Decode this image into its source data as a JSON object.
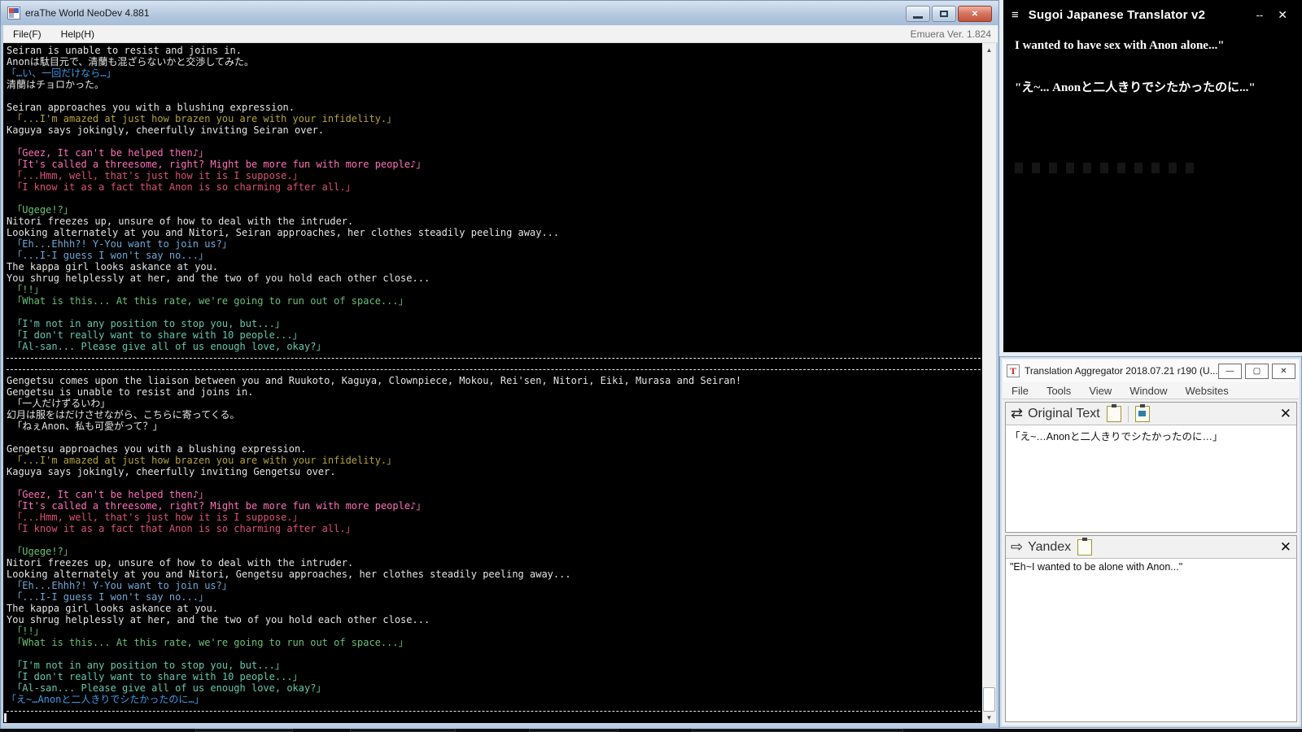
{
  "colors": {
    "white": "#e4e4e4",
    "blue": "#3f9ce8",
    "olive": "#b5a23a",
    "pink": "#ff70b8",
    "crimson": "#dc5078",
    "green": "#68c078",
    "steel": "#6fa8d8",
    "teal": "#63c7ad"
  },
  "era_window": {
    "title": "eraThe World NeoDev 4.881",
    "menu": {
      "file": "File(F)",
      "help": "Help(H)",
      "version": "Emuera Ver. 1.824"
    },
    "console_lines": [
      {
        "color": "white",
        "text": "Seiran is unable to resist and joins in."
      },
      {
        "color": "white",
        "text": "Anonは駄目元で、清蘭も混ざらないかと交渉してみた。"
      },
      {
        "color": "blue",
        "text": "「…い、一回だけなら…」"
      },
      {
        "color": "white",
        "text": "清蘭はチョロかった。"
      },
      {
        "color": "white",
        "text": ""
      },
      {
        "color": "white",
        "text": "Seiran approaches you with a blushing expression."
      },
      {
        "color": "olive",
        "text": " 「...I'm amazed at just how brazen you are with your infidelity.」"
      },
      {
        "color": "white",
        "text": "Kaguya says jokingly, cheerfully inviting Seiran over."
      },
      {
        "color": "white",
        "text": ""
      },
      {
        "color": "pink",
        "text": " 「Geez, It can't be helped then♪」"
      },
      {
        "color": "pink",
        "text": " 「It's called a threesome, right? Might be more fun with more people♪」"
      },
      {
        "color": "crimson",
        "text": " 「...Hmm, well, that's just how it is I suppose.」"
      },
      {
        "color": "crimson",
        "text": " 「I know it as a fact that Anon is so charming after all.」"
      },
      {
        "color": "white",
        "text": ""
      },
      {
        "color": "green",
        "text": " 「Ugege!?」"
      },
      {
        "color": "white",
        "text": "Nitori freezes up, unsure of how to deal with the intruder."
      },
      {
        "color": "white",
        "text": "Looking alternately at you and Nitori, Seiran approaches, her clothes steadily peeling away..."
      },
      {
        "color": "steel",
        "text": " 「Eh...Ehhh?! Y-You want to join us?」"
      },
      {
        "color": "steel",
        "text": " 「...I-I guess I won't say no...」"
      },
      {
        "color": "white",
        "text": "The kappa girl looks askance at you."
      },
      {
        "color": "white",
        "text": "You shrug helplessly at her, and the two of you hold each other close..."
      },
      {
        "color": "green",
        "text": " 「!!」"
      },
      {
        "color": "green",
        "text": " 「What is this... At this rate, we're going to run out of space...」"
      },
      {
        "color": "white",
        "text": ""
      },
      {
        "color": "teal",
        "text": " 「I'm not in any position to stop you, but...」"
      },
      {
        "color": "teal",
        "text": " 「I don't really want to share with 10 people...」"
      },
      {
        "color": "teal",
        "text": " 「Al-san... Please give all of us enough love, okay?」"
      },
      {
        "type": "hr"
      },
      {
        "type": "hr"
      },
      {
        "color": "white",
        "text": "Gengetsu comes upon the liaison between you and Ruukoto, Kaguya, Clownpiece, Mokou, Rei'sen, Nitori, Eiki, Murasa and Seiran!"
      },
      {
        "color": "white",
        "text": "Gengetsu is unable to resist and joins in."
      },
      {
        "color": "white",
        "text": " 「一人だけずるいわ」"
      },
      {
        "color": "white",
        "text": "幻月は服をはだけさせながら、こちらに寄ってくる。"
      },
      {
        "color": "white",
        "text": " 「ねぇAnon、私も可愛がって？」"
      },
      {
        "color": "white",
        "text": ""
      },
      {
        "color": "white",
        "text": "Gengetsu approaches you with a blushing expression."
      },
      {
        "color": "olive",
        "text": " 「...I'm amazed at just how brazen you are with your infidelity.」"
      },
      {
        "color": "white",
        "text": "Kaguya says jokingly, cheerfully inviting Gengetsu over."
      },
      {
        "color": "white",
        "text": ""
      },
      {
        "color": "pink",
        "text": " 「Geez, It can't be helped then♪」"
      },
      {
        "color": "pink",
        "text": " 「It's called a threesome, right? Might be more fun with more people♪」"
      },
      {
        "color": "crimson",
        "text": " 「...Hmm, well, that's just how it is I suppose.」"
      },
      {
        "color": "crimson",
        "text": " 「I know it as a fact that Anon is so charming after all.」"
      },
      {
        "color": "white",
        "text": ""
      },
      {
        "color": "green",
        "text": " 「Ugege!?」"
      },
      {
        "color": "white",
        "text": "Nitori freezes up, unsure of how to deal with the intruder."
      },
      {
        "color": "white",
        "text": "Looking alternately at you and Nitori, Gengetsu approaches, her clothes steadily peeling away..."
      },
      {
        "color": "steel",
        "text": " 「Eh...Ehhh?! Y-You want to join us?」"
      },
      {
        "color": "steel",
        "text": " 「...I-I guess I won't say no...」"
      },
      {
        "color": "white",
        "text": "The kappa girl looks askance at you."
      },
      {
        "color": "white",
        "text": "You shrug helplessly at her, and the two of you hold each other close..."
      },
      {
        "color": "green",
        "text": " 「!!」"
      },
      {
        "color": "green",
        "text": " 「What is this... At this rate, we're going to run out of space...」"
      },
      {
        "color": "white",
        "text": ""
      },
      {
        "color": "teal",
        "text": " 「I'm not in any position to stop you, but...」"
      },
      {
        "color": "teal",
        "text": " 「I don't really want to share with 10 people...」"
      },
      {
        "color": "teal",
        "text": " 「Al-san... Please give all of us enough love, okay?」"
      },
      {
        "color": "blue",
        "text": "「え~…Anonと二人きりでシたかったのに…」"
      },
      {
        "type": "hr"
      }
    ]
  },
  "sugoi_window": {
    "menu_icon": "≡",
    "title": "Sugoi Japanese Translator v2",
    "minimize_label": "--",
    "close_label": "✕",
    "lines": [
      "I wanted to have sex with Anon alone...\"",
      "\"え~... Anonと二人きりでシたかったのに...\""
    ],
    "placeholder_square_count": 11
  },
  "ta_window": {
    "title": "Translation Aggregator 2018.07.21 r190 (U...",
    "app_icon_letter": "T",
    "menu_items": [
      "File",
      "Tools",
      "View",
      "Window",
      "Websites"
    ],
    "panes": [
      {
        "arrow": "⇄",
        "label": "Original Text",
        "text": "「え~…Anonと二人きりでシたかったのに…」",
        "close": "✕"
      },
      {
        "arrow": "⇨",
        "label": "Yandex",
        "text": "\"Eh~I wanted to be alone with Anon...\"",
        "close": "✕"
      }
    ]
  }
}
